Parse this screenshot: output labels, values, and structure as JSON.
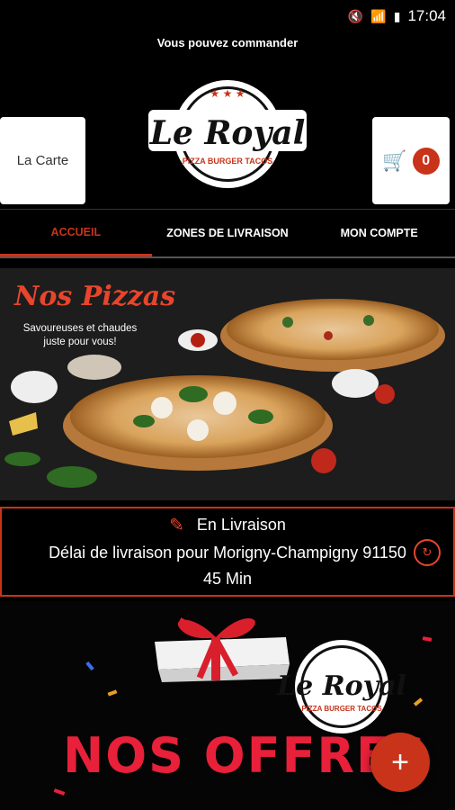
{
  "status_bar": {
    "time": "17:04"
  },
  "notice": "Vous pouvez commander",
  "header": {
    "carte_label": "La Carte",
    "cart_count": "0",
    "logo": {
      "name": "Le Royal",
      "tagline": "PIZZA BURGER TACOS"
    }
  },
  "tabs": [
    {
      "label": "ACCUEIL",
      "active": true
    },
    {
      "label": "ZONES DE LIVRAISON",
      "active": false
    },
    {
      "label": "MON COMPTE",
      "active": false
    }
  ],
  "banner": {
    "title": "Nos Pizzas",
    "subtitle": "Savoureuses et chaudes juste pour vous!"
  },
  "delivery": {
    "mode": "En Livraison",
    "description": "Délai de livraison pour Morigny-Champigny 91150",
    "time": "45 Min"
  },
  "offers": {
    "title": "NOS OFFRES",
    "logo_name": "Le Royal",
    "logo_tagline": "PIZZA BURGER TACOS"
  },
  "colors": {
    "accent": "#c9331a",
    "background": "#000000"
  }
}
